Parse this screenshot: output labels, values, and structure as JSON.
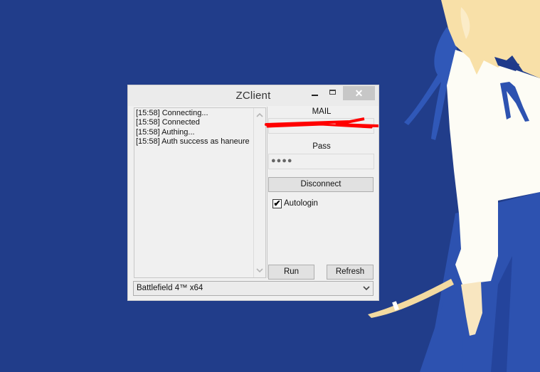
{
  "window": {
    "title": "ZClient",
    "controls": {
      "minimize": "minimize",
      "maximize": "maximize",
      "close": "✕"
    }
  },
  "log": {
    "lines": [
      "[15:58] Connecting...",
      "[15:58] Connected",
      "[15:58] Authing...",
      "[15:58] Auth success as haneure"
    ],
    "scroll_up": "˄",
    "scroll_down": "˅"
  },
  "login": {
    "mail_label": "MAIL",
    "mail_value": "",
    "mail_redacted": true,
    "pass_label": "Pass",
    "pass_value": "●●●●",
    "disconnect_label": "Disconnect",
    "autologin_label": "Autologin",
    "autologin_checked": true,
    "autologin_check_glyph": "✔"
  },
  "actions": {
    "run_label": "Run",
    "refresh_label": "Refresh"
  },
  "game_select": {
    "selected": "Battlefield 4™ x64",
    "arrow": "⌵"
  },
  "colors": {
    "desktop_bg": "#213d8a",
    "window_bg": "#f0f0f0",
    "close_button_bg": "#c7c7c7",
    "redaction_red": "#ff0000"
  }
}
